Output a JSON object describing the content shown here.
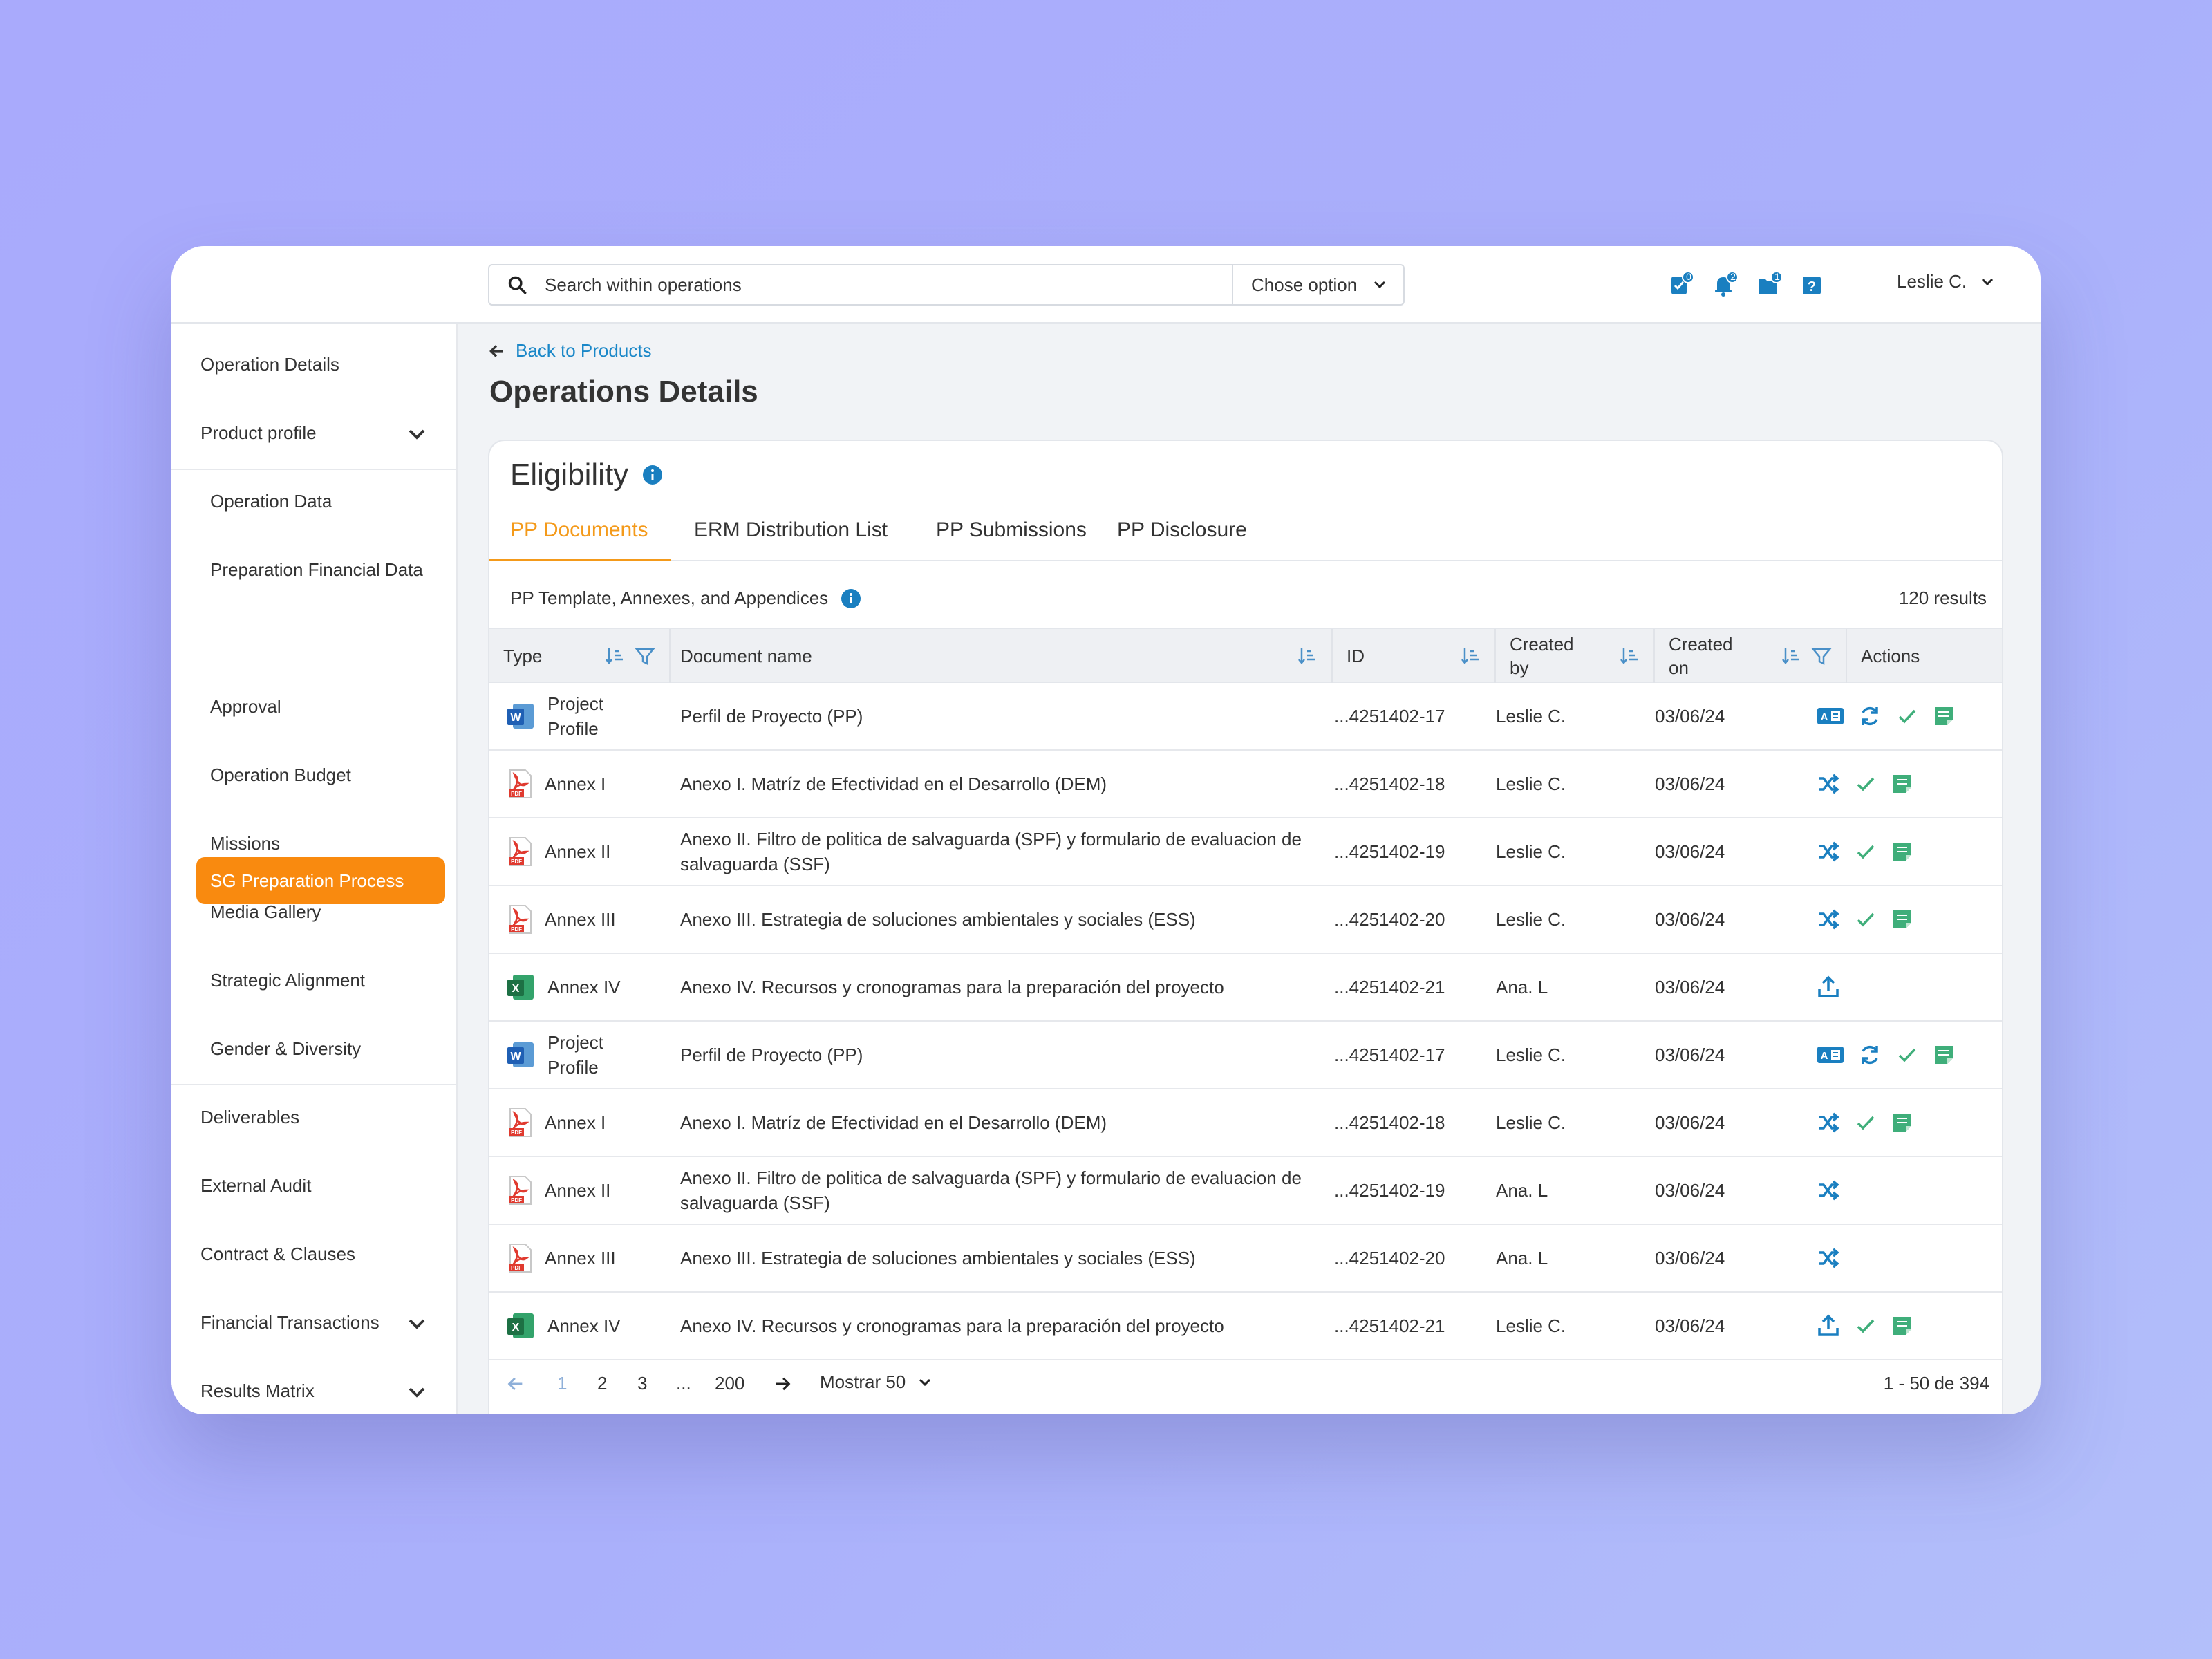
{
  "search": {
    "placeholder": "Search within operations",
    "option_label": "Chose option"
  },
  "topbar": {
    "icons": [
      {
        "name": "tasks-icon",
        "badge": "0"
      },
      {
        "name": "bell-icon",
        "badge": "2"
      },
      {
        "name": "folder-icon",
        "badge": "1"
      },
      {
        "name": "help-icon",
        "badge": ""
      }
    ],
    "user_name": "Leslie C."
  },
  "sidebar": {
    "items": [
      {
        "label": "Operation Details"
      },
      {
        "label": "Product profile"
      },
      {
        "label": "Operation Data"
      },
      {
        "label": "Preparation Financial Data"
      },
      {
        "label": "SG Preparation Process"
      },
      {
        "label": "Approval"
      },
      {
        "label": "Operation Budget"
      },
      {
        "label": "Missions"
      },
      {
        "label": "Media Gallery"
      },
      {
        "label": "Strategic Alignment"
      },
      {
        "label": "Gender & Diversity"
      },
      {
        "label": "Deliverables"
      },
      {
        "label": "External Audit"
      },
      {
        "label": "Contract & Clauses"
      },
      {
        "label": "Financial Transactions"
      },
      {
        "label": "Results Matrix"
      }
    ]
  },
  "main": {
    "back_label": "Back to Products",
    "page_title": "Operations Details",
    "card_title": "Eligibility",
    "tabs": [
      {
        "label": "PP Documents"
      },
      {
        "label": "ERM Distribution List"
      },
      {
        "label": "PP Submissions"
      },
      {
        "label": "PP Disclosure"
      }
    ],
    "subheading": "PP Template, Annexes, and Appendices",
    "results_count": "120 results"
  },
  "table": {
    "columns": {
      "type": "Type",
      "name": "Document name",
      "id": "ID",
      "created_by": "Created by",
      "created_on": "Created on",
      "actions": "Actions"
    },
    "rows": [
      {
        "file": "word",
        "type": "Project Profile",
        "name": "Perfil de Proyecto (PP)",
        "id": "...4251402-17",
        "by": "Leslie C.",
        "on": "03/06/24",
        "actions": [
          "translate",
          "refresh",
          "check",
          "note"
        ]
      },
      {
        "file": "pdf",
        "type": "Annex I",
        "name": "Anexo I. Matríz de Efectividad en el Desarrollo (DEM)",
        "id": "...4251402-18",
        "by": "Leslie C.",
        "on": "03/06/24",
        "actions": [
          "shuffle",
          "check",
          "note"
        ]
      },
      {
        "file": "pdf",
        "type": "Annex II",
        "name": "Anexo II. Filtro de politica de salvaguarda (SPF) y formulario de evaluacion de salvaguarda (SSF)",
        "id": "...4251402-19",
        "by": "Leslie C.",
        "on": "03/06/24",
        "actions": [
          "shuffle",
          "check",
          "note"
        ]
      },
      {
        "file": "pdf",
        "type": "Annex III",
        "name": "Anexo III. Estrategia de soluciones ambientales y sociales (ESS)",
        "id": "...4251402-20",
        "by": "Leslie C.",
        "on": "03/06/24",
        "actions": [
          "shuffle",
          "check",
          "note"
        ]
      },
      {
        "file": "excel",
        "type": "Annex IV",
        "name": "Anexo IV. Recursos y cronogramas para la preparación del proyecto",
        "id": "...4251402-21",
        "by": "Ana. L",
        "on": "03/06/24",
        "actions": [
          "upload"
        ]
      },
      {
        "file": "word",
        "type": "Project Profile",
        "name": "Perfil de Proyecto (PP)",
        "id": "...4251402-17",
        "by": "Leslie C.",
        "on": "03/06/24",
        "actions": [
          "translate",
          "refresh",
          "check",
          "note"
        ]
      },
      {
        "file": "pdf",
        "type": "Annex I",
        "name": "Anexo I. Matríz de Efectividad en el Desarrollo (DEM)",
        "id": "...4251402-18",
        "by": "Leslie C.",
        "on": "03/06/24",
        "actions": [
          "shuffle",
          "check",
          "note"
        ]
      },
      {
        "file": "pdf",
        "type": "Annex II",
        "name": "Anexo II. Filtro de politica de salvaguarda (SPF) y formulario de evaluacion de salvaguarda (SSF)",
        "id": "...4251402-19",
        "by": "Ana. L",
        "on": "03/06/24",
        "actions": [
          "shuffle"
        ]
      },
      {
        "file": "pdf",
        "type": "Annex III",
        "name": "Anexo III. Estrategia de soluciones ambientales y sociales (ESS)",
        "id": "...4251402-20",
        "by": "Ana. L",
        "on": "03/06/24",
        "actions": [
          "shuffle"
        ]
      },
      {
        "file": "excel",
        "type": "Annex IV",
        "name": "Anexo IV. Recursos y cronogramas para la preparación del proyecto",
        "id": "...4251402-21",
        "by": "Leslie C.",
        "on": "03/06/24",
        "actions": [
          "upload",
          "check",
          "note"
        ]
      }
    ]
  },
  "pagination": {
    "pages": [
      "1",
      "2",
      "3",
      "...",
      "200"
    ],
    "current_page": "1",
    "page_size_label": "Mostrar 50",
    "range_label": "1 - 50 de 394"
  },
  "colors": {
    "accent": "#f98a0f",
    "link": "#1a87c8",
    "action_blue": "#1a7fc0",
    "action_green": "#3fae7a"
  }
}
